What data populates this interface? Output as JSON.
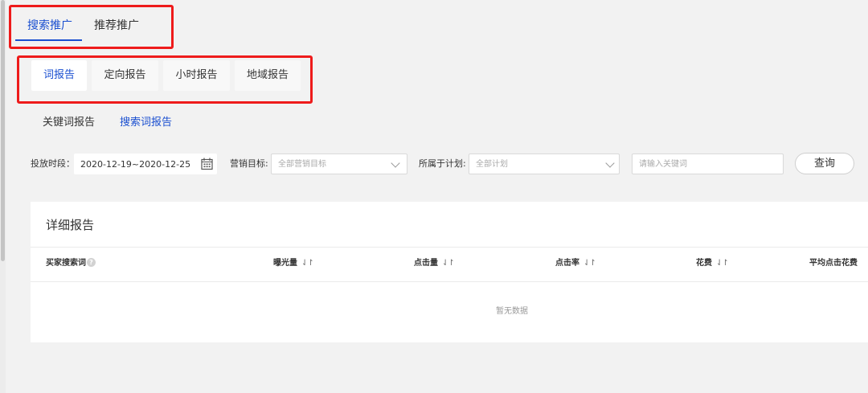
{
  "promo_tabs": [
    {
      "label": "搜索推广",
      "active": true
    },
    {
      "label": "推荐推广",
      "active": false
    }
  ],
  "report_tabs": [
    {
      "label": "词报告",
      "active": true
    },
    {
      "label": "定向报告",
      "active": false
    },
    {
      "label": "小时报告",
      "active": false
    },
    {
      "label": "地域报告",
      "active": false
    }
  ],
  "sub_tabs": [
    {
      "label": "关键词报告",
      "active": false
    },
    {
      "label": "搜索词报告",
      "active": true
    }
  ],
  "filters": {
    "date_label": "投放时段：",
    "date_value": "2020-12-19~2020-12-25",
    "goal_label": "营销目标:",
    "goal_placeholder": "全部营销目标",
    "plan_label": "所属于计划:",
    "plan_placeholder": "全部计划",
    "keyword_placeholder": "请输入关键词",
    "query_button": "查询"
  },
  "panel": {
    "title": "详细报告",
    "columns": [
      {
        "label": "买家搜索词",
        "help": true,
        "sortable": false
      },
      {
        "label": "曝光量",
        "sortable": true
      },
      {
        "label": "点击量",
        "sortable": true
      },
      {
        "label": "点击率",
        "sortable": true
      },
      {
        "label": "花费",
        "sortable": true
      },
      {
        "label": "平均点击花费",
        "sortable": false
      }
    ],
    "empty_text": "暂无数据"
  },
  "icons": {
    "sort": "⇃↾",
    "help": "?",
    "calendar": "calendar-icon",
    "dropdown": "chevron-down-icon"
  },
  "colors": {
    "accent": "#1a4fd0",
    "highlight": "#ee1b1b",
    "background": "#f2f2f2"
  }
}
